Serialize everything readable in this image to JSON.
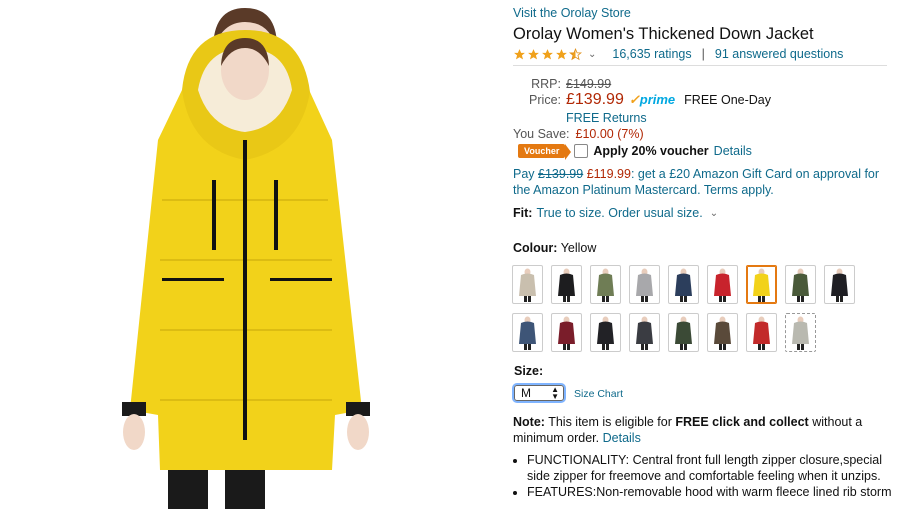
{
  "store_link": "Visit the Orolay Store",
  "product_title": "Orolay Women's Thickened Down Jacket",
  "rating": {
    "stars": 4.5,
    "count": "16,635 ratings",
    "separator": "|",
    "questions": "91 answered questions"
  },
  "pricing": {
    "rrp_label": "RRP:",
    "rrp_value": "£149.99",
    "price_label": "Price:",
    "price_value": "£139.99",
    "prime": "prime",
    "delivery": "FREE One-Day",
    "returns": "FREE Returns",
    "save_label": "You Save:",
    "save_value": "£10.00 (7%)"
  },
  "voucher": {
    "badge": "Voucher",
    "text": "Apply 20% voucher",
    "details": "Details"
  },
  "pay_offer": {
    "pay": "Pay",
    "old": "£139.99",
    "new": "£119.99",
    "rest": ": get a £20 Amazon Gift Card on approval for the Amazon Platinum Mastercard. Terms apply."
  },
  "fit": {
    "label": "Fit:",
    "value": "True to size. Order usual size."
  },
  "colour": {
    "label": "Colour:",
    "value": "Yellow"
  },
  "swatches": [
    {
      "color": "#c9bfae",
      "name": "Beige"
    },
    {
      "color": "#1d1d1f",
      "name": "Black"
    },
    {
      "color": "#6f7d55",
      "name": "Army Green"
    },
    {
      "color": "#a8a8ab",
      "name": "Grey"
    },
    {
      "color": "#2c3e5c",
      "name": "Navy"
    },
    {
      "color": "#c8232c",
      "name": "Red"
    },
    {
      "color": "#f2d21a",
      "name": "Yellow",
      "selected": true
    },
    {
      "color": "#4a5a3a",
      "name": "Camo"
    },
    {
      "color": "#1f1f24",
      "name": "Black Fur"
    },
    {
      "color": "#3e5577",
      "name": "Blue"
    },
    {
      "color": "#7a1d2a",
      "name": "Wine"
    },
    {
      "color": "#222226",
      "name": "Black Hood"
    },
    {
      "color": "#3a3c42",
      "name": "Dark Grey"
    },
    {
      "color": "#3b4a36",
      "name": "Green Camo"
    },
    {
      "color": "#5a4a3a",
      "name": "Brown Camo"
    },
    {
      "color": "#c22a2a",
      "name": "Red Fur"
    },
    {
      "color": "#b9b9b0",
      "name": "Light Grey",
      "dashed": true
    }
  ],
  "size": {
    "label": "Size:",
    "value": "M",
    "chart_link": "Size Chart"
  },
  "note": {
    "label": "Note:",
    "text1": "This item is eligible for",
    "bold": "FREE click and collect",
    "text2": "without a minimum order.",
    "details": "Details"
  },
  "bullets": [
    "FUNCTIONALITY: Central front full length zipper closure,special side zipper for freemove and comfortable feeling when it unzips.",
    "FEATURES:Non-removable hood with warm fleece lined rib storm"
  ],
  "colors": {
    "link": "#0f6a8b",
    "price": "#b12704",
    "star": "#f0a11b",
    "voucher": "#e47911",
    "jacket": "#f2d21a"
  }
}
